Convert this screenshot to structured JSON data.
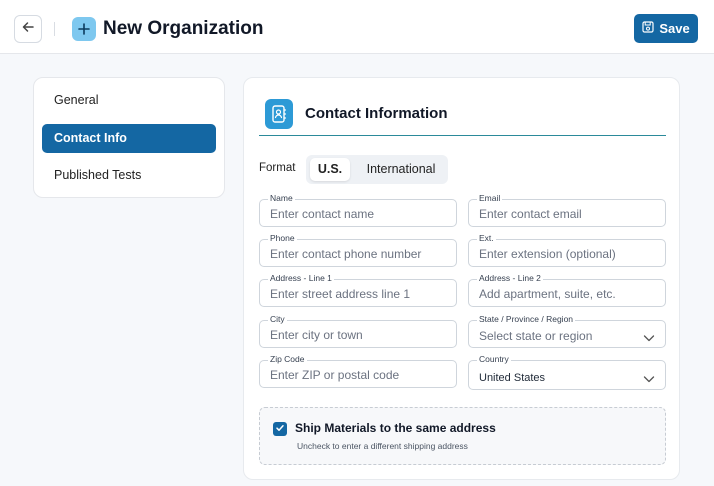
{
  "header": {
    "title": "New Organization",
    "save_label": "Save",
    "back_icon": "arrow-left-icon",
    "org_icon": "plus-icon",
    "save_icon": "save-icon"
  },
  "sidebar": {
    "items": [
      {
        "label": "General",
        "active": false
      },
      {
        "label": "Contact Info",
        "active": true
      },
      {
        "label": "Published Tests",
        "active": false
      }
    ]
  },
  "section": {
    "title": "Contact Information",
    "icon": "contact-book-icon"
  },
  "format": {
    "label": "Format",
    "options": [
      "U.S.",
      "International"
    ],
    "selected": "U.S."
  },
  "fields": {
    "name": {
      "label": "Name",
      "placeholder": "Enter contact name"
    },
    "email": {
      "label": "Email",
      "placeholder": "Enter contact email"
    },
    "phone": {
      "label": "Phone",
      "placeholder": "Enter contact phone number"
    },
    "ext": {
      "label": "Ext.",
      "placeholder": "Enter extension (optional)"
    },
    "address1": {
      "label": "Address - Line 1",
      "placeholder": "Enter street address line 1"
    },
    "address2": {
      "label": "Address - Line 2",
      "placeholder": "Add apartment, suite, etc."
    },
    "city": {
      "label": "City",
      "placeholder": "Enter city or town"
    },
    "state": {
      "label": "State / Province / Region",
      "placeholder": "Select state or region"
    },
    "zip": {
      "label": "Zip Code",
      "placeholder": "Enter ZIP or postal code"
    },
    "country": {
      "label": "Country",
      "value": "United States"
    }
  },
  "shipping": {
    "checked": true,
    "label": "Ship Materials to the same address",
    "hint": "Uncheck to enter a different shipping address"
  },
  "colors": {
    "primary": "#1467a3",
    "accent_icon": "#2d9ad6",
    "org_icon_bg": "#7ec8ef",
    "section_rule": "#2b8a9a"
  }
}
